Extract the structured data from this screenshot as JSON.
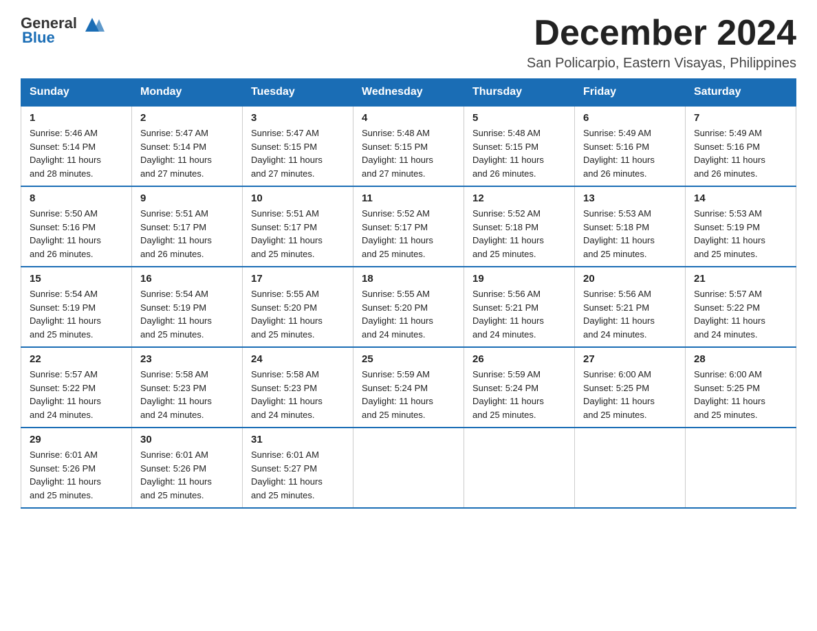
{
  "header": {
    "logo_general": "General",
    "logo_blue": "Blue",
    "month_title": "December 2024",
    "subtitle": "San Policarpio, Eastern Visayas, Philippines"
  },
  "days_of_week": [
    "Sunday",
    "Monday",
    "Tuesday",
    "Wednesday",
    "Thursday",
    "Friday",
    "Saturday"
  ],
  "weeks": [
    [
      {
        "day": "1",
        "sunrise": "5:46 AM",
        "sunset": "5:14 PM",
        "daylight": "11 hours and 28 minutes."
      },
      {
        "day": "2",
        "sunrise": "5:47 AM",
        "sunset": "5:14 PM",
        "daylight": "11 hours and 27 minutes."
      },
      {
        "day": "3",
        "sunrise": "5:47 AM",
        "sunset": "5:15 PM",
        "daylight": "11 hours and 27 minutes."
      },
      {
        "day": "4",
        "sunrise": "5:48 AM",
        "sunset": "5:15 PM",
        "daylight": "11 hours and 27 minutes."
      },
      {
        "day": "5",
        "sunrise": "5:48 AM",
        "sunset": "5:15 PM",
        "daylight": "11 hours and 26 minutes."
      },
      {
        "day": "6",
        "sunrise": "5:49 AM",
        "sunset": "5:16 PM",
        "daylight": "11 hours and 26 minutes."
      },
      {
        "day": "7",
        "sunrise": "5:49 AM",
        "sunset": "5:16 PM",
        "daylight": "11 hours and 26 minutes."
      }
    ],
    [
      {
        "day": "8",
        "sunrise": "5:50 AM",
        "sunset": "5:16 PM",
        "daylight": "11 hours and 26 minutes."
      },
      {
        "day": "9",
        "sunrise": "5:51 AM",
        "sunset": "5:17 PM",
        "daylight": "11 hours and 26 minutes."
      },
      {
        "day": "10",
        "sunrise": "5:51 AM",
        "sunset": "5:17 PM",
        "daylight": "11 hours and 25 minutes."
      },
      {
        "day": "11",
        "sunrise": "5:52 AM",
        "sunset": "5:17 PM",
        "daylight": "11 hours and 25 minutes."
      },
      {
        "day": "12",
        "sunrise": "5:52 AM",
        "sunset": "5:18 PM",
        "daylight": "11 hours and 25 minutes."
      },
      {
        "day": "13",
        "sunrise": "5:53 AM",
        "sunset": "5:18 PM",
        "daylight": "11 hours and 25 minutes."
      },
      {
        "day": "14",
        "sunrise": "5:53 AM",
        "sunset": "5:19 PM",
        "daylight": "11 hours and 25 minutes."
      }
    ],
    [
      {
        "day": "15",
        "sunrise": "5:54 AM",
        "sunset": "5:19 PM",
        "daylight": "11 hours and 25 minutes."
      },
      {
        "day": "16",
        "sunrise": "5:54 AM",
        "sunset": "5:19 PM",
        "daylight": "11 hours and 25 minutes."
      },
      {
        "day": "17",
        "sunrise": "5:55 AM",
        "sunset": "5:20 PM",
        "daylight": "11 hours and 25 minutes."
      },
      {
        "day": "18",
        "sunrise": "5:55 AM",
        "sunset": "5:20 PM",
        "daylight": "11 hours and 24 minutes."
      },
      {
        "day": "19",
        "sunrise": "5:56 AM",
        "sunset": "5:21 PM",
        "daylight": "11 hours and 24 minutes."
      },
      {
        "day": "20",
        "sunrise": "5:56 AM",
        "sunset": "5:21 PM",
        "daylight": "11 hours and 24 minutes."
      },
      {
        "day": "21",
        "sunrise": "5:57 AM",
        "sunset": "5:22 PM",
        "daylight": "11 hours and 24 minutes."
      }
    ],
    [
      {
        "day": "22",
        "sunrise": "5:57 AM",
        "sunset": "5:22 PM",
        "daylight": "11 hours and 24 minutes."
      },
      {
        "day": "23",
        "sunrise": "5:58 AM",
        "sunset": "5:23 PM",
        "daylight": "11 hours and 24 minutes."
      },
      {
        "day": "24",
        "sunrise": "5:58 AM",
        "sunset": "5:23 PM",
        "daylight": "11 hours and 24 minutes."
      },
      {
        "day": "25",
        "sunrise": "5:59 AM",
        "sunset": "5:24 PM",
        "daylight": "11 hours and 25 minutes."
      },
      {
        "day": "26",
        "sunrise": "5:59 AM",
        "sunset": "5:24 PM",
        "daylight": "11 hours and 25 minutes."
      },
      {
        "day": "27",
        "sunrise": "6:00 AM",
        "sunset": "5:25 PM",
        "daylight": "11 hours and 25 minutes."
      },
      {
        "day": "28",
        "sunrise": "6:00 AM",
        "sunset": "5:25 PM",
        "daylight": "11 hours and 25 minutes."
      }
    ],
    [
      {
        "day": "29",
        "sunrise": "6:01 AM",
        "sunset": "5:26 PM",
        "daylight": "11 hours and 25 minutes."
      },
      {
        "day": "30",
        "sunrise": "6:01 AM",
        "sunset": "5:26 PM",
        "daylight": "11 hours and 25 minutes."
      },
      {
        "day": "31",
        "sunrise": "6:01 AM",
        "sunset": "5:27 PM",
        "daylight": "11 hours and 25 minutes."
      },
      null,
      null,
      null,
      null
    ]
  ],
  "labels": {
    "sunrise": "Sunrise:",
    "sunset": "Sunset:",
    "daylight": "Daylight:"
  }
}
